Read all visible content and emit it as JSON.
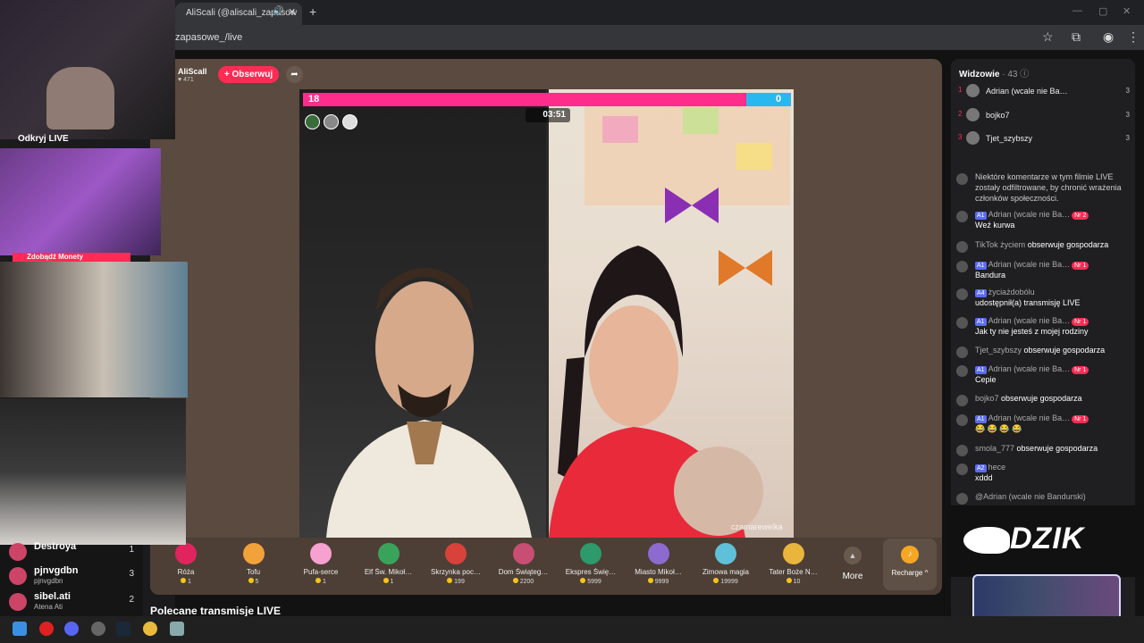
{
  "browser": {
    "tab_title": "AliScali (@aliscali_zapasow",
    "url": "zapasowe_/live",
    "new_tab_symbol": "+",
    "close_symbol": "✕"
  },
  "stream": {
    "host_name": "AliScall",
    "host_likes": "♥ 471",
    "follow_label": "+ Obserwuj",
    "score_left": "18",
    "score_right": "0",
    "timer": "03:51",
    "watermark": "czamarewelka"
  },
  "gifts": [
    {
      "name": "Róża",
      "price": "1",
      "color": "#e0245e"
    },
    {
      "name": "Tofu",
      "price": "5",
      "color": "#f2a23a"
    },
    {
      "name": "Pufa-serce",
      "price": "1",
      "color": "#f7a1d0"
    },
    {
      "name": "Elf Św. Mikoł…",
      "price": "1",
      "color": "#3aa35b"
    },
    {
      "name": "Skrzynka poc…",
      "price": "199",
      "color": "#d8423b"
    },
    {
      "name": "Dom Świąteg…",
      "price": "2200",
      "color": "#c94e73"
    },
    {
      "name": "Ekspres Świę…",
      "price": "5999",
      "color": "#2d9a6b"
    },
    {
      "name": "Miasto Mikoł…",
      "price": "9999",
      "color": "#8c6ad0"
    },
    {
      "name": "Zimowa magia",
      "price": "19999",
      "color": "#5fc0d9"
    },
    {
      "name": "Tater Boże N…",
      "price": "10",
      "color": "#e9b53d"
    }
  ],
  "more_label": "More",
  "recharge_label": "Recharge ^",
  "recommended_title": "Polecane transmisje LIVE",
  "viewers": {
    "title": "Widzowie",
    "count": "· 43",
    "top": [
      {
        "rank": "1",
        "name": "Adrian (wcale nie Ba…",
        "score": "3"
      },
      {
        "rank": "2",
        "name": "bojko7",
        "score": "3"
      },
      {
        "rank": "3",
        "name": "Tjet_szybszy",
        "score": "3"
      }
    ]
  },
  "chat": [
    {
      "user": "",
      "text": "Niektóre komentarze w tym filmie LIVE zostały odfiltrowane, by chronić wrażenia członków społeczności.",
      "badge": "",
      "nr": ""
    },
    {
      "user": "Adrian (wcale nie Ba…",
      "text": "Weź kurwa",
      "badge": "A1",
      "nr": "Nr 2"
    },
    {
      "user": "TikTok życiem",
      "text": "obserwuje gospodarza",
      "badge": "",
      "nr": ""
    },
    {
      "user": "Adrian (wcale nie Ba…",
      "text": "Bandura",
      "badge": "A1",
      "nr": "Nr 1"
    },
    {
      "user": "życiażdobólu",
      "text": "udostępnił(a) transmisję LIVE",
      "badge": "A4",
      "nr": ""
    },
    {
      "user": "Adrian (wcale nie Ba…",
      "text": "Jak ty nie jesteś z mojej rodziny",
      "badge": "A1",
      "nr": "Nr 1"
    },
    {
      "user": "Tjet_szybszy",
      "text": "obserwuje gospodarza",
      "badge": "",
      "nr": ""
    },
    {
      "user": "Adrian (wcale nie Ba…",
      "text": "Cepie",
      "badge": "A1",
      "nr": "Nr 1"
    },
    {
      "user": "bojko7",
      "text": "obserwuje gospodarza",
      "badge": "",
      "nr": ""
    },
    {
      "user": "Adrian (wcale nie Ba…",
      "text": "😂 😂 😂 😂",
      "badge": "A1",
      "nr": "Nr 1"
    },
    {
      "user": "smola_777",
      "text": "obserwuje gospodarza",
      "badge": "",
      "nr": ""
    },
    {
      "user": "hece",
      "text": "xddd",
      "badge": "A2",
      "nr": ""
    },
    {
      "user": "@Adrian (wcale nie Bandurski)",
      "text": "",
      "badge": "",
      "nr": ""
    }
  ],
  "overlay": {
    "cam1_label": "Odkryj LIVE",
    "cam2_label": "Zdobądź Monety",
    "dzik_logo": "DZIK",
    "left_list": [
      {
        "name": "Destroya",
        "sub": "",
        "num": "1"
      },
      {
        "name": "pjnvgdbn",
        "sub": "pjnvgdbn",
        "num": "3"
      },
      {
        "name": "sibel.ati",
        "sub": "Atena Ati",
        "num": "2"
      }
    ]
  },
  "colors": {
    "accent": "#fe2c55",
    "battle_left": "#fe2c8a",
    "battle_right": "#28b8f0",
    "stage_bg": "#5a4a3f"
  }
}
